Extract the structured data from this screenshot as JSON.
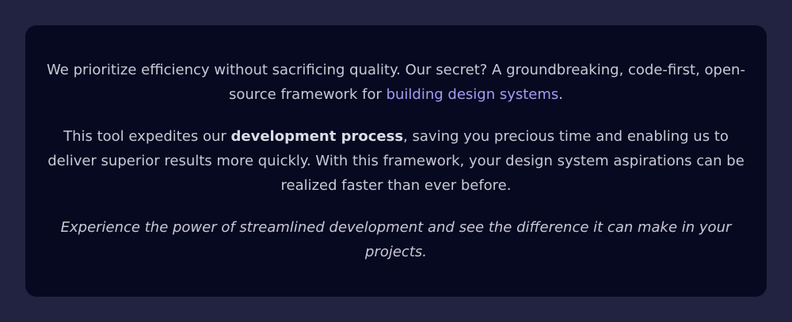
{
  "colors": {
    "page_background": "#222340",
    "card_background": "#070920",
    "text": "#c8c8d6",
    "link": "#a59bf5"
  },
  "paragraph1": {
    "text_before": "We prioritize efficiency without sacrificing quality. Our secret? A groundbreaking, code-first, open-source framework for ",
    "link_text": "building design systems",
    "text_after": "."
  },
  "paragraph2": {
    "text_before": "This tool expedites our ",
    "bold_text": "development process",
    "text_after": ", saving you precious time and enabling us to deliver superior results more quickly. With this framework, your design system aspirations can be realized faster than ever before."
  },
  "paragraph3": {
    "text": "Experience the power of streamlined development and see the difference it can make in your projects."
  }
}
